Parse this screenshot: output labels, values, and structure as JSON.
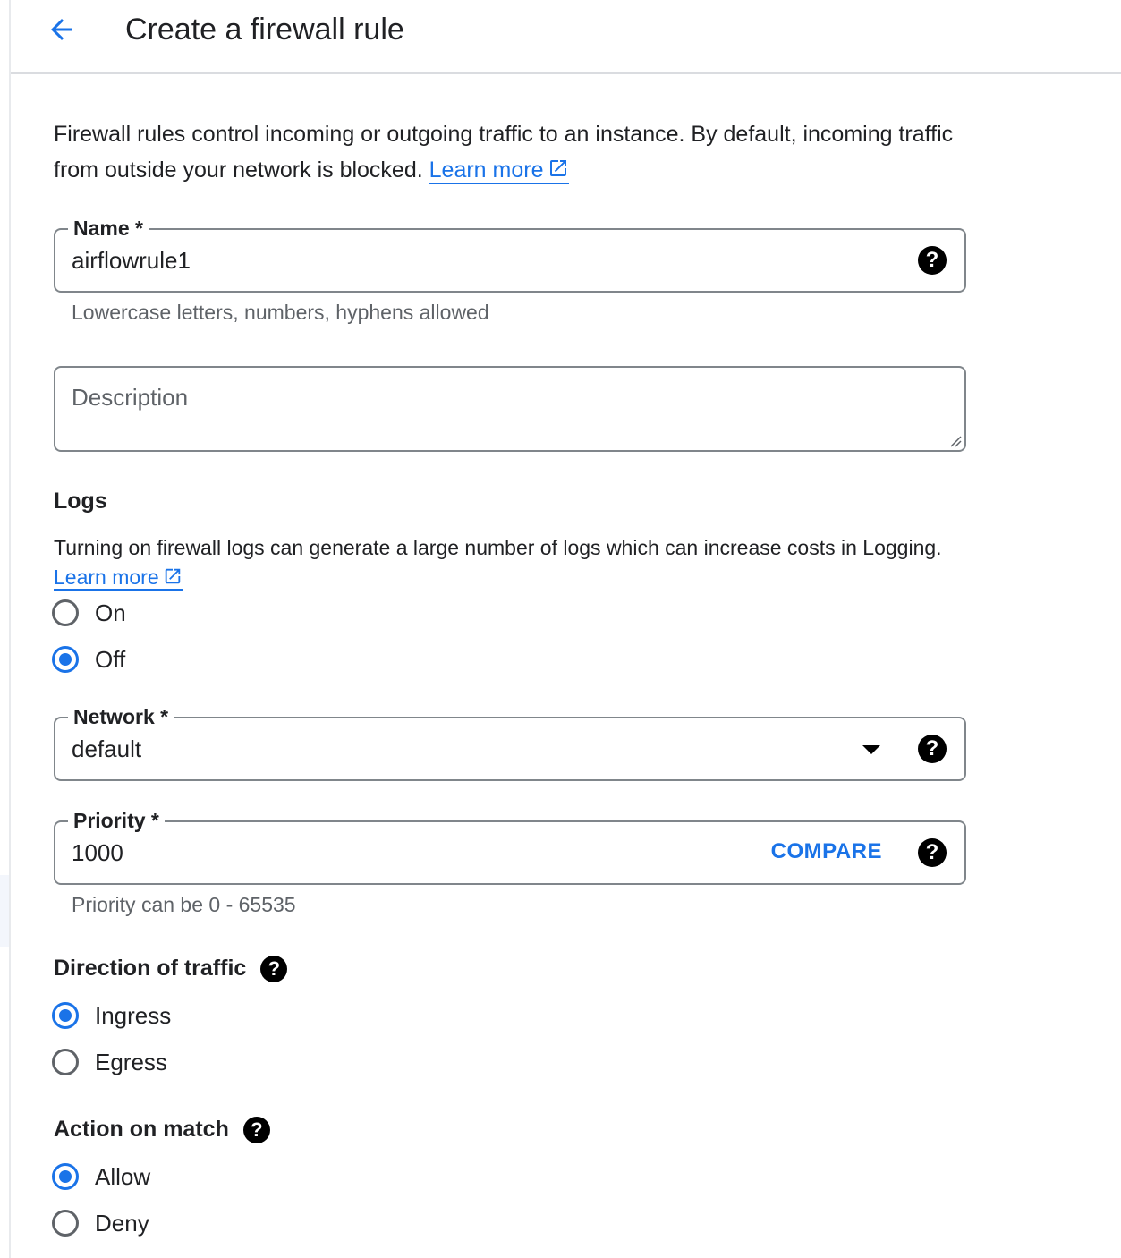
{
  "header": {
    "title": "Create a firewall rule"
  },
  "intro": {
    "text": "Firewall rules control incoming or outgoing traffic to an instance. By default, incoming traffic from outside your network is blocked.",
    "link": "Learn more"
  },
  "name_field": {
    "label": "Name *",
    "value": "airflowrule1",
    "hint": "Lowercase letters, numbers, hyphens allowed"
  },
  "description_field": {
    "placeholder": "Description",
    "value": ""
  },
  "logs": {
    "title": "Logs",
    "description": " Turning on firewall logs can generate a large number of logs which can increase costs in Logging.",
    "link": "Learn more",
    "options": [
      {
        "label": "On",
        "checked": false
      },
      {
        "label": "Off",
        "checked": true
      }
    ]
  },
  "network_field": {
    "label": "Network *",
    "value": "default"
  },
  "priority_field": {
    "label": "Priority *",
    "value": "1000",
    "compare_label": "COMPARE",
    "hint": "Priority can be 0 - 65535"
  },
  "direction": {
    "title": "Direction of traffic",
    "options": [
      {
        "label": "Ingress",
        "checked": true
      },
      {
        "label": "Egress",
        "checked": false
      }
    ]
  },
  "action": {
    "title": "Action on match",
    "options": [
      {
        "label": "Allow",
        "checked": true
      },
      {
        "label": "Deny",
        "checked": false
      }
    ]
  },
  "colors": {
    "accent": "#1a73e8",
    "text": "#202124",
    "secondary_text": "#5f6368",
    "border": "#80868b"
  },
  "icons": {
    "back": "arrow-back-icon",
    "help": "help-circle-icon",
    "external": "open-in-new-icon",
    "dropdown": "triangle-down-icon"
  }
}
